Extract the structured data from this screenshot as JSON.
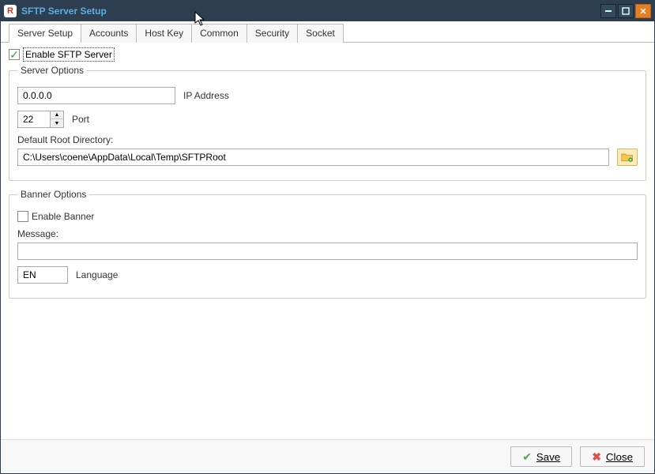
{
  "window": {
    "title": "SFTP Server Setup"
  },
  "tabs": {
    "items": [
      {
        "label": "Server Setup",
        "active": true
      },
      {
        "label": "Accounts"
      },
      {
        "label": "Host Key"
      },
      {
        "label": "Common"
      },
      {
        "label": "Security"
      },
      {
        "label": "Socket"
      }
    ]
  },
  "enable_server": {
    "label": "Enable SFTP Server",
    "checked": true
  },
  "server_options": {
    "legend": "Server Options",
    "ip": {
      "value": "0.0.0.0",
      "label": "IP Address"
    },
    "port": {
      "value": "22",
      "label": "Port"
    },
    "root_dir_label": "Default Root Directory:",
    "root_dir_value": "C:\\Users\\coene\\AppData\\Local\\Temp\\SFTPRoot"
  },
  "banner_options": {
    "legend": "Banner Options",
    "enable": {
      "label": "Enable Banner",
      "checked": false
    },
    "message_label": "Message:",
    "message_value": "",
    "language": {
      "value": "EN",
      "label": "Language"
    }
  },
  "footer": {
    "save": "Save",
    "close": "Close"
  }
}
